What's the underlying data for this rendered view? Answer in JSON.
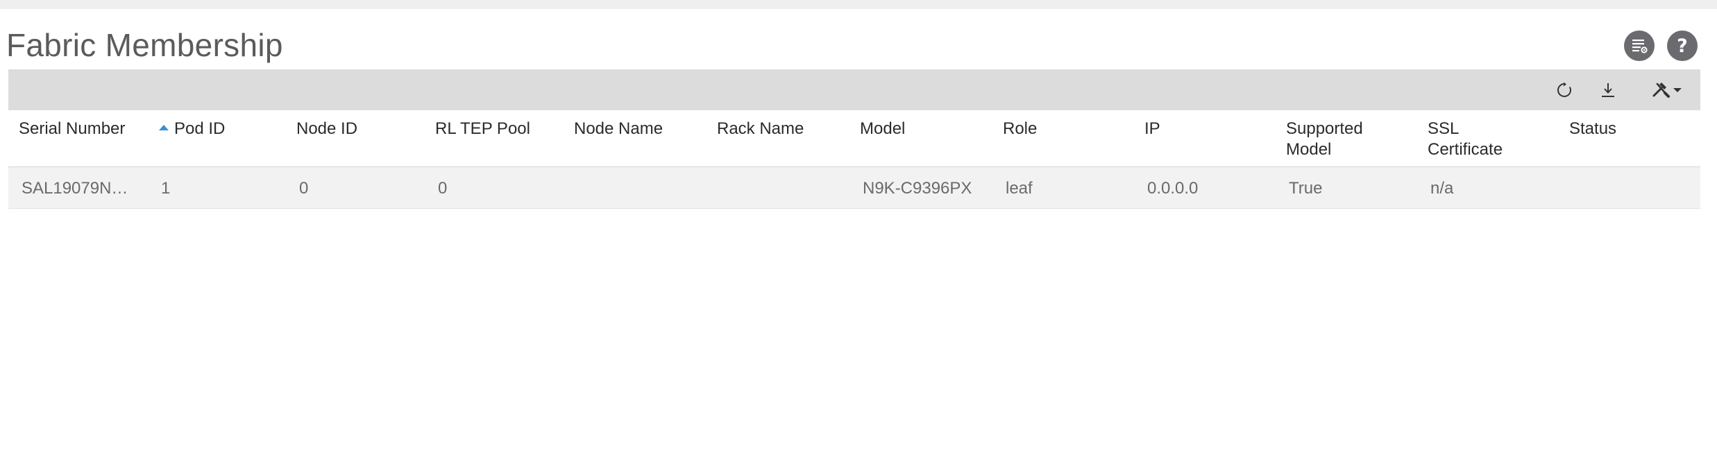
{
  "page": {
    "title": "Fabric Membership"
  },
  "header_actions": {
    "list_icon": "list-settings-icon",
    "help_icon": "help-icon",
    "help_glyph": "?"
  },
  "toolbar": {
    "refresh_icon": "refresh-icon",
    "download_icon": "download-icon",
    "tools_icon": "tools-dropdown-icon"
  },
  "table": {
    "sort": {
      "column": "Pod ID",
      "direction": "ascending"
    },
    "columns": [
      "Serial Number",
      "Pod ID",
      "Node ID",
      "RL TEP Pool",
      "Node Name",
      "Rack Name",
      "Model",
      "Role",
      "IP",
      "Supported Model",
      "SSL Certificate",
      "Status"
    ],
    "header_lines": {
      "supported_model": [
        "Supported",
        "Model"
      ],
      "ssl_certificate": [
        "SSL",
        "Certificate"
      ]
    },
    "rows": [
      {
        "serial_number": "SAL19079N…",
        "pod_id": "1",
        "node_id": "0",
        "rl_tep_pool": "0",
        "node_name": "",
        "rack_name": "",
        "model": "N9K-C9396PX",
        "role": "leaf",
        "ip": "0.0.0.0",
        "supported_model": "True",
        "ssl_certificate": "n/a",
        "status": ""
      }
    ]
  },
  "colors": {
    "header_button_bg": "#6b6b6f",
    "toolbar_bg": "#dcdcdc",
    "row_bg": "#f2f2f2",
    "sort_indicator": "#3a8ed6"
  }
}
